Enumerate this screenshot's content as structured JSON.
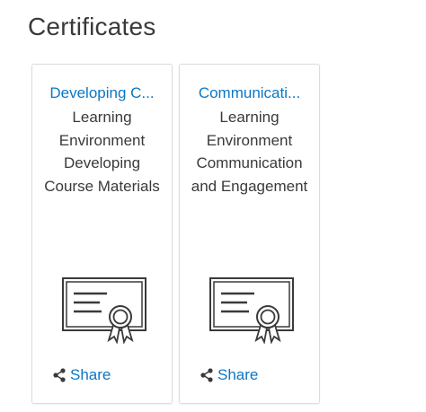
{
  "page": {
    "title": "Certificates"
  },
  "certificates": [
    {
      "title": "Developing C...",
      "description": "Learning Environment Developing Course Materials",
      "share_label": "Share"
    },
    {
      "title": "Communicati...",
      "description": "Learning Environment Communication and Engagement",
      "share_label": "Share"
    }
  ],
  "icons": {
    "certificate": "certificate-icon",
    "share": "share-icon"
  },
  "colors": {
    "link": "#0b77c5",
    "text": "#3a3a3a",
    "card_border": "#dcdcdc"
  }
}
